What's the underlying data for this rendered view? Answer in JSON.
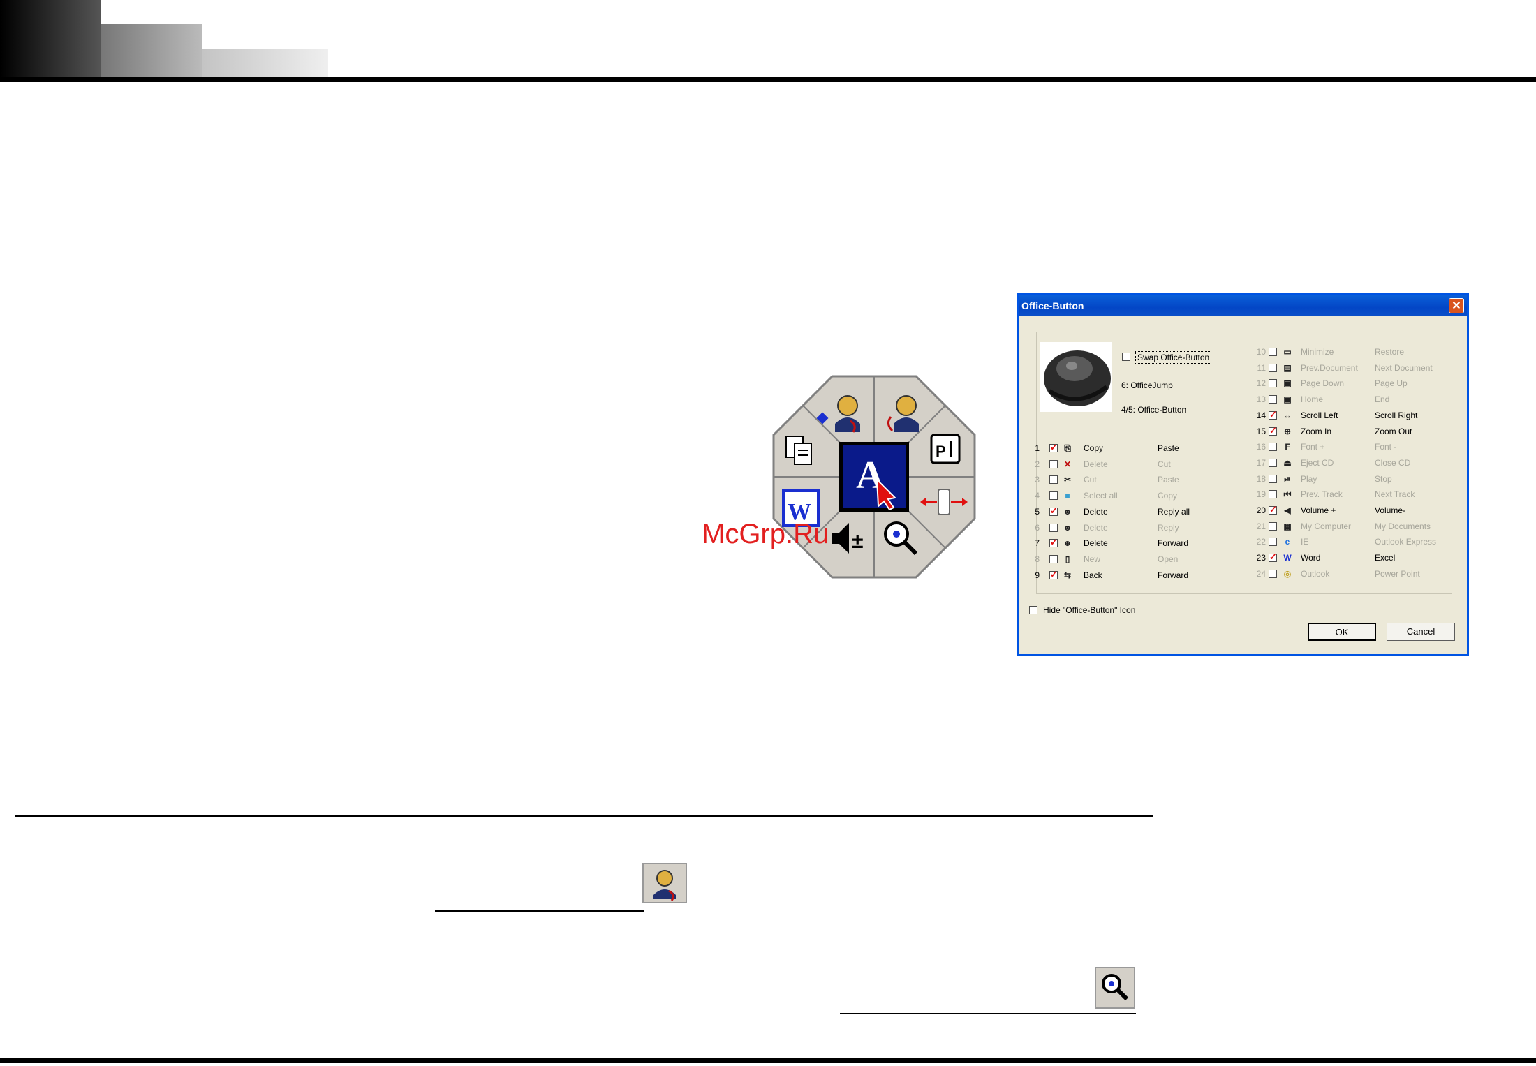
{
  "watermark": "McGrp.Ru",
  "dialog": {
    "title": "Office-Button",
    "swap_label": "Swap Office-Button",
    "swap_checked": false,
    "button6_label": "6: OfficeJump",
    "button45_label": "4/5: Office-Button",
    "hide_icon_label": "Hide \"Office-Button\" Icon",
    "hide_icon_checked": false,
    "ok_label": "OK",
    "cancel_label": "Cancel",
    "left_items": [
      {
        "num": "1",
        "checked": true,
        "icon": "copy-icon",
        "a": "Copy",
        "b": "Paste",
        "enabled": true
      },
      {
        "num": "2",
        "checked": false,
        "icon": "delete-x-icon",
        "a": "Delete",
        "b": "Cut",
        "enabled": false
      },
      {
        "num": "3",
        "checked": false,
        "icon": "scissors-icon",
        "a": "Cut",
        "b": "Paste",
        "enabled": false
      },
      {
        "num": "4",
        "checked": false,
        "icon": "select-all-icon",
        "a": "Select all",
        "b": "Copy",
        "enabled": false
      },
      {
        "num": "5",
        "checked": true,
        "icon": "reply-all-icon",
        "a": "Delete",
        "b": "Reply all",
        "enabled": true
      },
      {
        "num": "6",
        "checked": false,
        "icon": "reply-icon",
        "a": "Delete",
        "b": "Reply",
        "enabled": false
      },
      {
        "num": "7",
        "checked": true,
        "icon": "forward-icon",
        "a": "Delete",
        "b": "Forward",
        "enabled": true
      },
      {
        "num": "8",
        "checked": false,
        "icon": "new-document-icon",
        "a": "New",
        "b": "Open",
        "enabled": false
      },
      {
        "num": "9",
        "checked": true,
        "icon": "back-forward-icon",
        "a": "Back",
        "b": "Forward",
        "enabled": true
      }
    ],
    "right_items": [
      {
        "num": "10",
        "checked": false,
        "icon": "minimize-icon",
        "a": "Minimize",
        "b": "Restore",
        "enabled": false
      },
      {
        "num": "11",
        "checked": false,
        "icon": "prev-document-icon",
        "a": "Prev.Document",
        "b": "Next Document",
        "enabled": false
      },
      {
        "num": "12",
        "checked": false,
        "icon": "page-down-icon",
        "a": "Page Down",
        "b": "Page Up",
        "enabled": false
      },
      {
        "num": "13",
        "checked": false,
        "icon": "home-icon",
        "a": "Home",
        "b": "End",
        "enabled": false
      },
      {
        "num": "14",
        "checked": true,
        "icon": "scroll-horizontal-icon",
        "a": "Scroll Left",
        "b": "Scroll Right",
        "enabled": true
      },
      {
        "num": "15",
        "checked": true,
        "icon": "zoom-icon",
        "a": "Zoom In",
        "b": "Zoom Out",
        "enabled": true
      },
      {
        "num": "16",
        "checked": false,
        "icon": "font-size-icon",
        "a": "Font +",
        "b": "Font -",
        "enabled": false
      },
      {
        "num": "17",
        "checked": false,
        "icon": "eject-icon",
        "a": "Eject CD",
        "b": "Close CD",
        "enabled": false
      },
      {
        "num": "18",
        "checked": false,
        "icon": "play-pause-icon",
        "a": "Play",
        "b": "Stop",
        "enabled": false
      },
      {
        "num": "19",
        "checked": false,
        "icon": "prev-track-icon",
        "a": "Prev. Track",
        "b": "Next Track",
        "enabled": false
      },
      {
        "num": "20",
        "checked": true,
        "icon": "volume-icon",
        "a": "Volume +",
        "b": "Volume-",
        "enabled": true
      },
      {
        "num": "21",
        "checked": false,
        "icon": "my-computer-icon",
        "a": "My Computer",
        "b": "My Documents",
        "enabled": false
      },
      {
        "num": "22",
        "checked": false,
        "icon": "ie-icon",
        "a": "IE",
        "b": "Outlook Express",
        "enabled": false
      },
      {
        "num": "23",
        "checked": true,
        "icon": "word-icon",
        "a": "Word",
        "b": "Excel",
        "enabled": true
      },
      {
        "num": "24",
        "checked": false,
        "icon": "outlook-icon",
        "a": "Outlook",
        "b": "Power Point",
        "enabled": false
      }
    ]
  },
  "colors": {
    "title_bar": "#0346c6",
    "check": "#e01010",
    "disabled_text": "#a7a69b",
    "watermark": "#e21f1f"
  }
}
